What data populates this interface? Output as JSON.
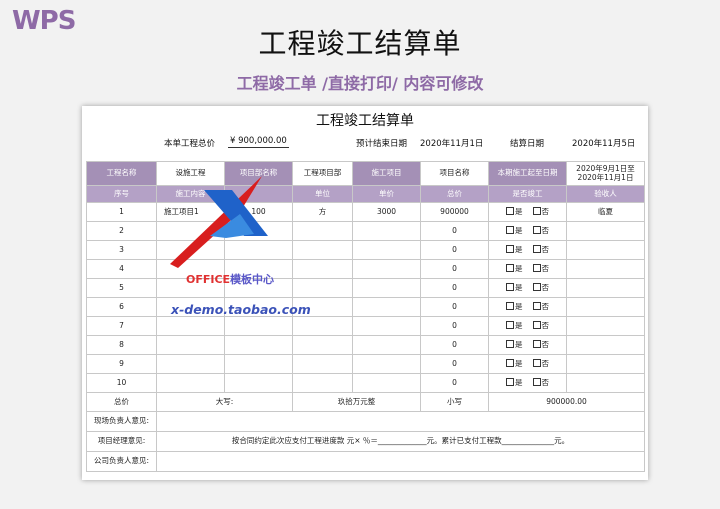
{
  "brand": "WPS",
  "page_title": "工程竣工结算单",
  "subtitle": "工程竣工单 /直接打印/ 内容可修改",
  "sheet": {
    "title": "工程竣工结算单",
    "total_label": "本单工程总价",
    "total_value": "¥  900,000.00",
    "planned_end_label": "预计结束日期",
    "planned_end_value": "2020年11月1日",
    "settle_label": "结算日期",
    "settle_value": "2020年11月5日"
  },
  "header1": {
    "project_name_label": "工程名称",
    "project_name_value": "设施工程",
    "dept_label": "项目部名称",
    "dept_value": "工程项目部",
    "item_label": "施工项目",
    "item_value": "项目名称",
    "period_label": "本期施工起至日期",
    "period_line1": "2020年9月1日至",
    "period_line2": "2020年11月1日"
  },
  "columns": [
    "序号",
    "施工内容",
    "",
    "单位",
    "单价",
    "总价",
    "是否竣工",
    "验收人"
  ],
  "rows": [
    {
      "no": "1",
      "content": "施工项目1",
      "qty": "100",
      "unit": "方",
      "price": "3000",
      "total": "900000",
      "yes": "是",
      "no_opt": "否",
      "inspector": "临夏"
    },
    {
      "no": "2",
      "content": "",
      "qty": "",
      "unit": "",
      "price": "",
      "total": "0",
      "yes": "是",
      "no_opt": "否",
      "inspector": ""
    },
    {
      "no": "3",
      "content": "",
      "qty": "",
      "unit": "",
      "price": "",
      "total": "0",
      "yes": "是",
      "no_opt": "否",
      "inspector": ""
    },
    {
      "no": "4",
      "content": "",
      "qty": "",
      "unit": "",
      "price": "",
      "total": "0",
      "yes": "是",
      "no_opt": "否",
      "inspector": ""
    },
    {
      "no": "5",
      "content": "",
      "qty": "",
      "unit": "",
      "price": "",
      "total": "0",
      "yes": "是",
      "no_opt": "否",
      "inspector": ""
    },
    {
      "no": "6",
      "content": "",
      "qty": "",
      "unit": "",
      "price": "",
      "total": "0",
      "yes": "是",
      "no_opt": "否",
      "inspector": ""
    },
    {
      "no": "7",
      "content": "",
      "qty": "",
      "unit": "",
      "price": "",
      "total": "0",
      "yes": "是",
      "no_opt": "否",
      "inspector": ""
    },
    {
      "no": "8",
      "content": "",
      "qty": "",
      "unit": "",
      "price": "",
      "total": "0",
      "yes": "是",
      "no_opt": "否",
      "inspector": ""
    },
    {
      "no": "9",
      "content": "",
      "qty": "",
      "unit": "",
      "price": "",
      "total": "0",
      "yes": "是",
      "no_opt": "否",
      "inspector": ""
    },
    {
      "no": "10",
      "content": "",
      "qty": "",
      "unit": "",
      "price": "",
      "total": "0",
      "yes": "是",
      "no_opt": "否",
      "inspector": ""
    }
  ],
  "totals": {
    "label": "总价",
    "upper_label": "大写:",
    "upper_value": "玖拾万元整",
    "lower_label": "小写",
    "lower_value": "900000.00"
  },
  "signoff": {
    "site_label": "现场负责人意见:",
    "pm_label": "项目经理意见:",
    "pm_text": "按合同约定此次应支付工程进度款    元× ％＝_____________元。累计已支付工程款______________元。",
    "company_label": "公司负责人意见:"
  },
  "watermark": {
    "office_en": "OFFICE",
    "office_cn": "模板中心",
    "url": "x-demo.taobao.com"
  },
  "colors": {
    "accent": "#8e6aa6",
    "header_dark": "#a490b6",
    "header_light": "#b4a1c6"
  }
}
